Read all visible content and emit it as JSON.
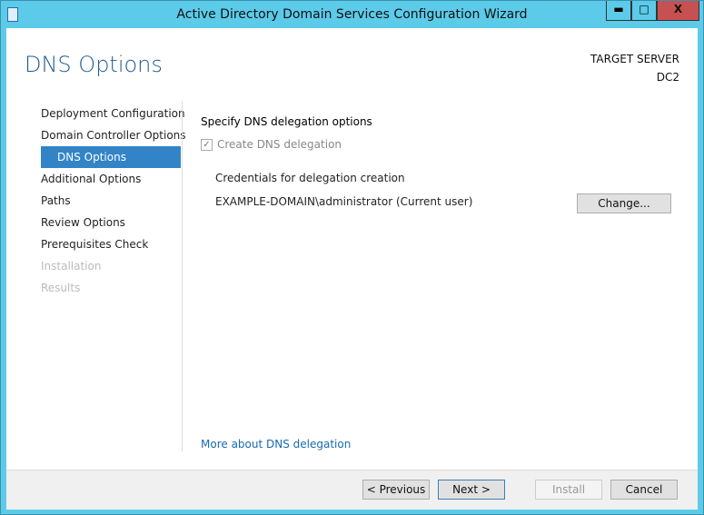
{
  "window": {
    "title": "Active Directory Domain Services Configuration Wizard",
    "minimize": "▬",
    "maximize": "□",
    "close": "X"
  },
  "header": {
    "title": "DNS Options",
    "target_label": "TARGET SERVER",
    "target_value": "DC2"
  },
  "nav": [
    "Deployment Configuration",
    "Domain Controller Options",
    "DNS Options",
    "Additional Options",
    "Paths",
    "Review Options",
    "Prerequisites Check",
    "Installation",
    "Results"
  ],
  "main": {
    "section": "Specify DNS delegation options",
    "checkbox": "Create DNS delegation",
    "check": "✓",
    "cred_label": "Credentials for delegation creation",
    "user": "EXAMPLE-DOMAIN\\administrator (Current user)",
    "change": "Change...",
    "link": "More about DNS delegation"
  },
  "footer": {
    "previous": "< Previous",
    "next": "Next >",
    "install": "Install",
    "cancel": "Cancel"
  }
}
